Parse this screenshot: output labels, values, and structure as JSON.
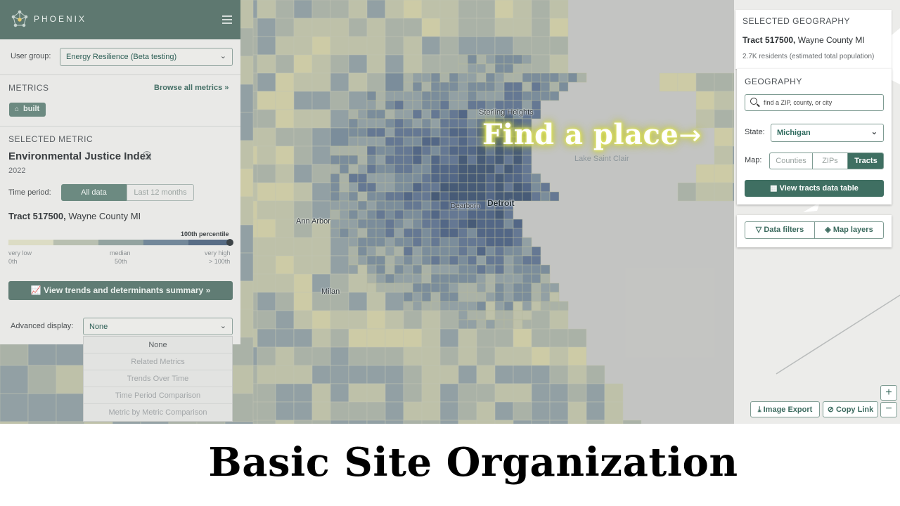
{
  "app": {
    "logo_text": "PHOENIX"
  },
  "left_panel": {
    "user_group_label": "User group:",
    "user_group_value": "Energy Resilience (Beta testing)",
    "metrics_title": "METRICS",
    "browse_all": "Browse all metrics",
    "badge_label": "built",
    "selected_metric_title": "SELECTED METRIC",
    "metric_name": "Environmental Justice Index",
    "metric_year": "2022",
    "time_period_label": "Time period:",
    "time_options": [
      "All data",
      "Last 12 months"
    ],
    "time_selected": "All data",
    "geo_tract": "Tract 517500,",
    "geo_county": "Wayne County MI",
    "percentile_label": "100th percentile",
    "percentile_value": 100,
    "scale_top": [
      "very low",
      "median",
      "very high"
    ],
    "scale_bottom": [
      "0th",
      "50th",
      "> 100th"
    ],
    "trends_button": "View trends and determinants summary",
    "advanced_label": "Advanced display:",
    "advanced_value": "None",
    "advanced_options": [
      "None",
      "Related Metrics",
      "Trends Over Time",
      "Time Period Comparison",
      "Metric by Metric Comparison"
    ]
  },
  "map": {
    "labels": {
      "sterling": "Sterling Heights",
      "ann_arbor": "Ann Arbor",
      "dearborn": "Dearborn",
      "detroit": "Detroit",
      "milan": "Milan",
      "lake": "Lake Saint Clair"
    },
    "callout": "Find a place"
  },
  "right_panel": {
    "selected_geo_title": "SELECTED GEOGRAPHY",
    "tract": "Tract 517500,",
    "county": "Wayne County MI",
    "population": "2.7K residents (estimated total population)",
    "geography_title": "GEOGRAPHY",
    "search_placeholder": "find a ZIP, county, or city",
    "state_label": "State:",
    "state_value": "Michigan",
    "map_label": "Map:",
    "map_levels": [
      "Counties",
      "ZIPs",
      "Tracts"
    ],
    "map_level_selected": "Tracts",
    "view_table": "View tracts data table",
    "data_filters": "Data filters",
    "map_layers": "Map layers",
    "image_export": "Image Export",
    "copy_link": "Copy Link",
    "zoom_in": "+",
    "zoom_out": "−"
  },
  "slide_title": "Basic Site Organization",
  "colors": {
    "brand": "#5e7870",
    "accent": "#3f6f62",
    "map_low": "#e8e3b0",
    "map_high": "#2e4a6a"
  }
}
